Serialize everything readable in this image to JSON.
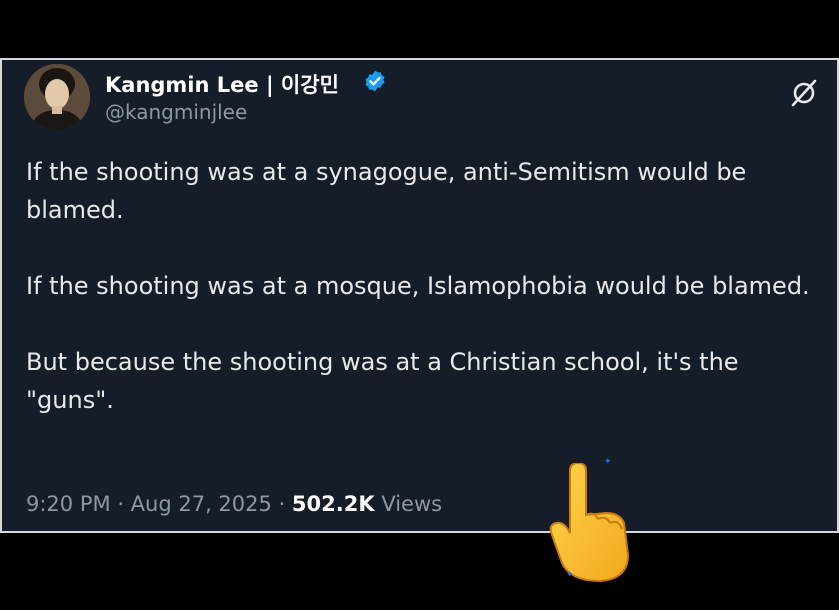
{
  "author": {
    "name": "Kangmin Lee | 이강민",
    "handle": "@kangminjlee",
    "verified": true
  },
  "tweet": {
    "paragraphs": [
      "If the shooting was at a synagogue, anti-Semitism would be blamed.",
      "If the shooting was at a mosque, Islamophobia would be blamed.",
      "But because the shooting was at a Christian school, it's the \"guns\"."
    ],
    "time": "9:20 PM",
    "date": "Aug 27, 2025",
    "views_count": "502.2K",
    "views_label": "Views"
  },
  "icons": {
    "verified": "verified-badge-icon",
    "grok": "grok-icon",
    "emoji": "backhand-index-pointing-up"
  },
  "colors": {
    "card_background": "#151d28",
    "verified_blue": "#1d9bf0",
    "secondary_text": "#8b98a5"
  }
}
